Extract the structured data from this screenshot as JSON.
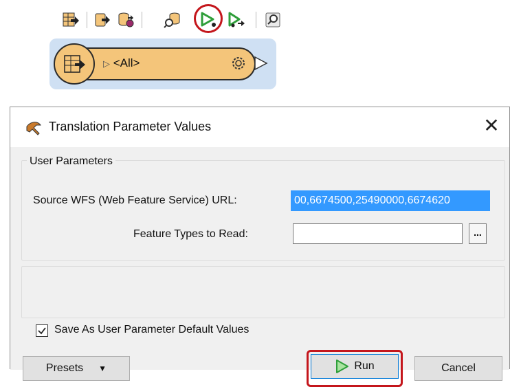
{
  "toolbar": {
    "buttons": [
      {
        "icon": "add-reader-icon"
      },
      {
        "icon": "add-writer-icon"
      },
      {
        "icon": "add-writer-alt-icon"
      },
      {
        "icon": "search-features-icon"
      },
      {
        "icon": "run-translation-icon"
      },
      {
        "icon": "run-to-this-icon"
      },
      {
        "icon": "inspect-icon"
      }
    ]
  },
  "node": {
    "label": "<All>",
    "icon": "reader-table-icon"
  },
  "dialog": {
    "title": "Translation Parameter Values",
    "group_title": "User Parameters",
    "source_url_label": "Source WFS (Web Feature Service) URL:",
    "source_url_value": "00,6674500,25490000,6674620",
    "feature_types_label": "Feature Types to Read:",
    "feature_types_value": "",
    "ellipsis_label": "...",
    "save_default_label": "Save As User Parameter Default Values",
    "save_default_checked": true,
    "presets_label": "Presets",
    "run_label": "Run",
    "cancel_label": "Cancel"
  },
  "colors": {
    "highlight_red": "#c4161c",
    "node_orange": "#f4c57a",
    "node_bg": "#cfe0f3",
    "selection_blue": "#3399ff",
    "run_green": "#2e9e3a"
  }
}
